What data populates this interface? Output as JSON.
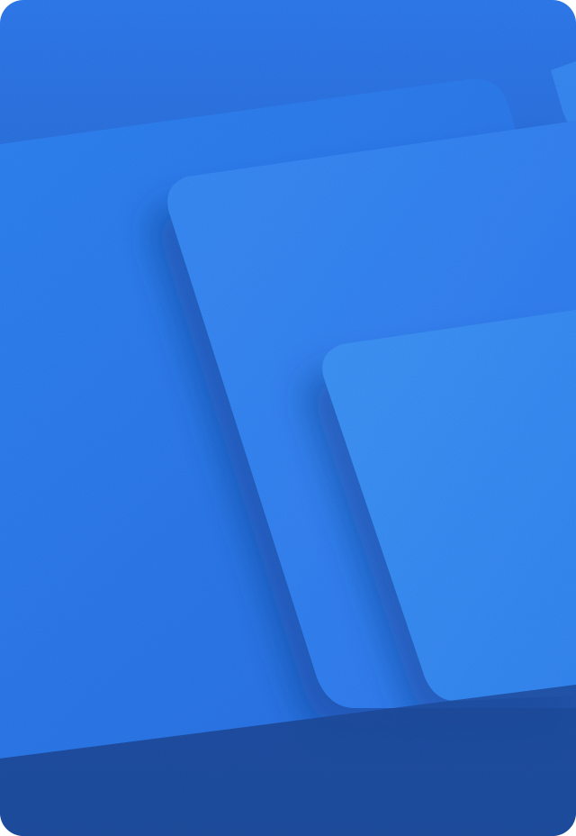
{
  "palette": {
    "background_top": "#2f7bef",
    "background_bottom": "#1f4fa3",
    "panel_back": "#2f82f6",
    "panel_middle": "#3488f7",
    "panel_front": "#3a8ff8",
    "shadow": "#1c4aa6"
  },
  "icons": [
    "abstract-layered-cards-illustration"
  ]
}
